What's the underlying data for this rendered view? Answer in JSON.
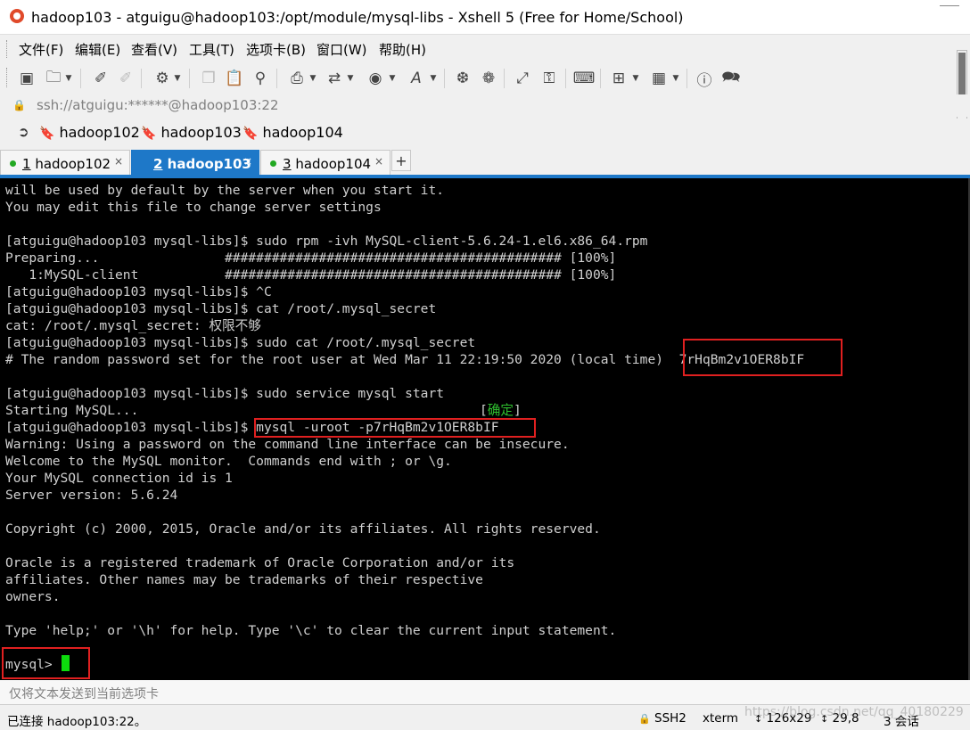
{
  "window": {
    "title": "hadoop103 - atguigu@hadoop103:/opt/module/mysql-libs - Xshell 5 (Free for Home/School)"
  },
  "menu": [
    "文件(F)",
    "编辑(E)",
    "查看(V)",
    "工具(T)",
    "选项卡(B)",
    "窗口(W)",
    "帮助(H)"
  ],
  "toolbar_icons": [
    "new-session-icon",
    "open-folder-icon",
    "reconnect-icon",
    "disconnect-icon",
    "properties-icon",
    "copy-icon",
    "paste-icon",
    "find-icon",
    "print-icon",
    "transfer-icon",
    "globe-icon",
    "font-icon",
    "xftp-icon",
    "xmanager-icon",
    "fullscreen-icon",
    "lock-icon",
    "keyboard-icon",
    "new-tab-icon",
    "layout-icon",
    "help-icon",
    "chat-icon"
  ],
  "address": "ssh://atguigu:******@hadoop103:22",
  "links": [
    "hadoop102",
    "hadoop103",
    "hadoop104"
  ],
  "tabs": [
    {
      "num": "1",
      "label": "hadoop102",
      "active": false
    },
    {
      "num": "2",
      "label": "hadoop103",
      "active": true
    },
    {
      "num": "3",
      "label": "hadoop104",
      "active": false
    }
  ],
  "terminal": {
    "lines": [
      "will be used by default by the server when you start it.",
      "You may edit this file to change server settings",
      "",
      "[atguigu@hadoop103 mysql-libs]$ sudo rpm -ivh MySQL-client-5.6.24-1.el6.x86_64.rpm",
      "Preparing...                ########################################### [100%]",
      "   1:MySQL-client           ########################################### [100%]",
      "[atguigu@hadoop103 mysql-libs]$ ^C",
      "[atguigu@hadoop103 mysql-libs]$ cat /root/.mysql_secret",
      "cat: /root/.mysql_secret: 权限不够",
      "[atguigu@hadoop103 mysql-libs]$ sudo cat /root/.mysql_secret",
      "# The random password set for the root user at Wed Mar 11 22:19:50 2020 (local time)  7rHqBm2v1OER8bIF",
      "",
      "[atguigu@hadoop103 mysql-libs]$ sudo service mysql start",
      "Starting MySQL...",
      "[atguigu@hadoop103 mysql-libs]$ mysql -uroot -p7rHqBm2v1OER8bIF",
      "Warning: Using a password on the command line interface can be insecure.",
      "Welcome to the MySQL monitor.  Commands end with ; or \\g.",
      "Your MySQL connection id is 1",
      "Server version: 5.6.24",
      "",
      "Copyright (c) 2000, 2015, Oracle and/or its affiliates. All rights reserved.",
      "",
      "Oracle is a registered trademark of Oracle Corporation and/or its",
      "affiliates. Other names may be trademarks of their respective",
      "owners.",
      "",
      "Type 'help;' or '\\h' for help. Type '\\c' to clear the current input statement.",
      "",
      "mysql> "
    ],
    "ok_open": "[",
    "ok_label": "确定",
    "ok_close": "]"
  },
  "send_placeholder": "仅将文本发送到当前选项卡",
  "status": {
    "connection": "已连接 hadoop103:22。",
    "protocol": "SSH2",
    "terminal_type": "xterm",
    "size": "126x29",
    "cursor_pos": "29,8",
    "sessions": "3 会话"
  },
  "watermark": "https://blog.csdn.net/qq_40180229",
  "colors": {
    "accent": "#1e78c8",
    "highlight": "#e02020",
    "cursor": "#0ddb0d"
  }
}
